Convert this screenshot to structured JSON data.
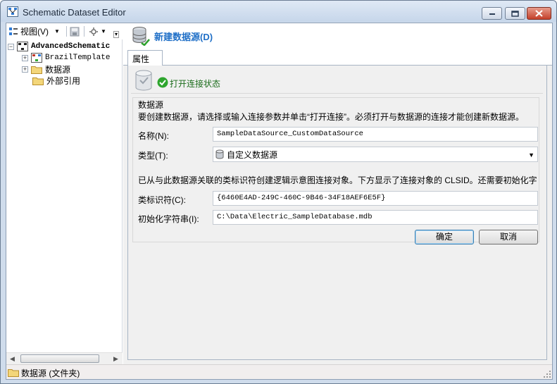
{
  "window": {
    "title": "Schematic Dataset Editor"
  },
  "toolbar": {
    "view_label": "视图(V)",
    "view_icon": "view-icon",
    "save_icon": "save-icon",
    "tools_icon": "tools-icon"
  },
  "tree": {
    "root": "AdvancedSchematic",
    "items": [
      {
        "label": "BrazilTemplate",
        "icon": "template-icon",
        "expandable": true
      },
      {
        "label": "数据源",
        "icon": "folder-icon",
        "expandable": true
      },
      {
        "label": "外部引用",
        "icon": "folder-icon",
        "expandable": false
      }
    ]
  },
  "header": {
    "title": "新建数据源(D)"
  },
  "tabs": [
    {
      "label": "属性",
      "active": true
    }
  ],
  "connection": {
    "status_text": "打开连接状态"
  },
  "datasource": {
    "group_title": "数据源",
    "description": "要创建数据源，请选择或输入连接参数并单击“打开连接”。必须打开与数据源的连接才能创建新数据源。",
    "name_label": "名称(N):",
    "name_value": "SampleDataSource_CustomDataSource",
    "type_label": "类型(T):",
    "type_value": "自定义数据源",
    "clsid_description": "已从与此数据源关联的类标识符创建逻辑示意图连接对象。下方显示了连接对象的 CLSID。还需要初始化字",
    "clsid_label": "类标识符(C):",
    "clsid_value": "{6460E4AD-249C-460C-9B46-34F18AEF6E5F}",
    "init_label": "初始化字符串(I):",
    "init_value": "C:\\Data\\Electric_SampleDatabase.mdb",
    "ok_label": "确定",
    "cancel_label": "取消"
  },
  "statusbar": {
    "text": "数据源 (文件夹)"
  },
  "colors": {
    "header_blue": "#1f6fc7",
    "status_green": "#1b6c1b"
  }
}
